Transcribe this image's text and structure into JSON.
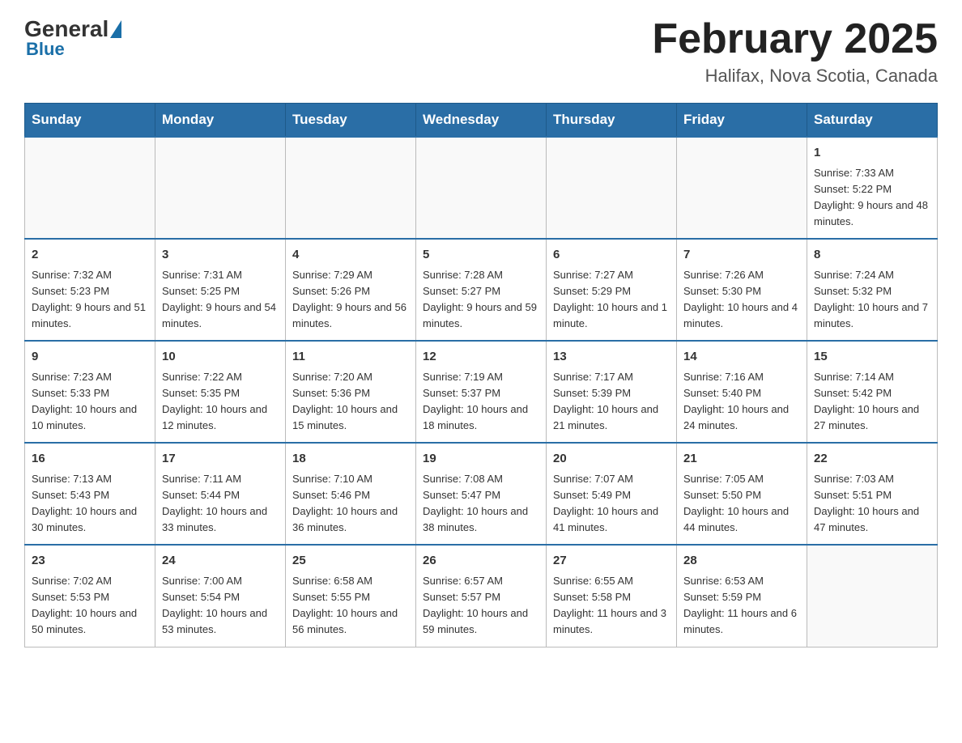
{
  "header": {
    "logo_general": "General",
    "logo_blue": "Blue",
    "month_title": "February 2025",
    "location": "Halifax, Nova Scotia, Canada"
  },
  "days_of_week": [
    "Sunday",
    "Monday",
    "Tuesday",
    "Wednesday",
    "Thursday",
    "Friday",
    "Saturday"
  ],
  "weeks": [
    [
      {
        "day": "",
        "info": ""
      },
      {
        "day": "",
        "info": ""
      },
      {
        "day": "",
        "info": ""
      },
      {
        "day": "",
        "info": ""
      },
      {
        "day": "",
        "info": ""
      },
      {
        "day": "",
        "info": ""
      },
      {
        "day": "1",
        "info": "Sunrise: 7:33 AM\nSunset: 5:22 PM\nDaylight: 9 hours and 48 minutes."
      }
    ],
    [
      {
        "day": "2",
        "info": "Sunrise: 7:32 AM\nSunset: 5:23 PM\nDaylight: 9 hours and 51 minutes."
      },
      {
        "day": "3",
        "info": "Sunrise: 7:31 AM\nSunset: 5:25 PM\nDaylight: 9 hours and 54 minutes."
      },
      {
        "day": "4",
        "info": "Sunrise: 7:29 AM\nSunset: 5:26 PM\nDaylight: 9 hours and 56 minutes."
      },
      {
        "day": "5",
        "info": "Sunrise: 7:28 AM\nSunset: 5:27 PM\nDaylight: 9 hours and 59 minutes."
      },
      {
        "day": "6",
        "info": "Sunrise: 7:27 AM\nSunset: 5:29 PM\nDaylight: 10 hours and 1 minute."
      },
      {
        "day": "7",
        "info": "Sunrise: 7:26 AM\nSunset: 5:30 PM\nDaylight: 10 hours and 4 minutes."
      },
      {
        "day": "8",
        "info": "Sunrise: 7:24 AM\nSunset: 5:32 PM\nDaylight: 10 hours and 7 minutes."
      }
    ],
    [
      {
        "day": "9",
        "info": "Sunrise: 7:23 AM\nSunset: 5:33 PM\nDaylight: 10 hours and 10 minutes."
      },
      {
        "day": "10",
        "info": "Sunrise: 7:22 AM\nSunset: 5:35 PM\nDaylight: 10 hours and 12 minutes."
      },
      {
        "day": "11",
        "info": "Sunrise: 7:20 AM\nSunset: 5:36 PM\nDaylight: 10 hours and 15 minutes."
      },
      {
        "day": "12",
        "info": "Sunrise: 7:19 AM\nSunset: 5:37 PM\nDaylight: 10 hours and 18 minutes."
      },
      {
        "day": "13",
        "info": "Sunrise: 7:17 AM\nSunset: 5:39 PM\nDaylight: 10 hours and 21 minutes."
      },
      {
        "day": "14",
        "info": "Sunrise: 7:16 AM\nSunset: 5:40 PM\nDaylight: 10 hours and 24 minutes."
      },
      {
        "day": "15",
        "info": "Sunrise: 7:14 AM\nSunset: 5:42 PM\nDaylight: 10 hours and 27 minutes."
      }
    ],
    [
      {
        "day": "16",
        "info": "Sunrise: 7:13 AM\nSunset: 5:43 PM\nDaylight: 10 hours and 30 minutes."
      },
      {
        "day": "17",
        "info": "Sunrise: 7:11 AM\nSunset: 5:44 PM\nDaylight: 10 hours and 33 minutes."
      },
      {
        "day": "18",
        "info": "Sunrise: 7:10 AM\nSunset: 5:46 PM\nDaylight: 10 hours and 36 minutes."
      },
      {
        "day": "19",
        "info": "Sunrise: 7:08 AM\nSunset: 5:47 PM\nDaylight: 10 hours and 38 minutes."
      },
      {
        "day": "20",
        "info": "Sunrise: 7:07 AM\nSunset: 5:49 PM\nDaylight: 10 hours and 41 minutes."
      },
      {
        "day": "21",
        "info": "Sunrise: 7:05 AM\nSunset: 5:50 PM\nDaylight: 10 hours and 44 minutes."
      },
      {
        "day": "22",
        "info": "Sunrise: 7:03 AM\nSunset: 5:51 PM\nDaylight: 10 hours and 47 minutes."
      }
    ],
    [
      {
        "day": "23",
        "info": "Sunrise: 7:02 AM\nSunset: 5:53 PM\nDaylight: 10 hours and 50 minutes."
      },
      {
        "day": "24",
        "info": "Sunrise: 7:00 AM\nSunset: 5:54 PM\nDaylight: 10 hours and 53 minutes."
      },
      {
        "day": "25",
        "info": "Sunrise: 6:58 AM\nSunset: 5:55 PM\nDaylight: 10 hours and 56 minutes."
      },
      {
        "day": "26",
        "info": "Sunrise: 6:57 AM\nSunset: 5:57 PM\nDaylight: 10 hours and 59 minutes."
      },
      {
        "day": "27",
        "info": "Sunrise: 6:55 AM\nSunset: 5:58 PM\nDaylight: 11 hours and 3 minutes."
      },
      {
        "day": "28",
        "info": "Sunrise: 6:53 AM\nSunset: 5:59 PM\nDaylight: 11 hours and 6 minutes."
      },
      {
        "day": "",
        "info": ""
      }
    ]
  ]
}
